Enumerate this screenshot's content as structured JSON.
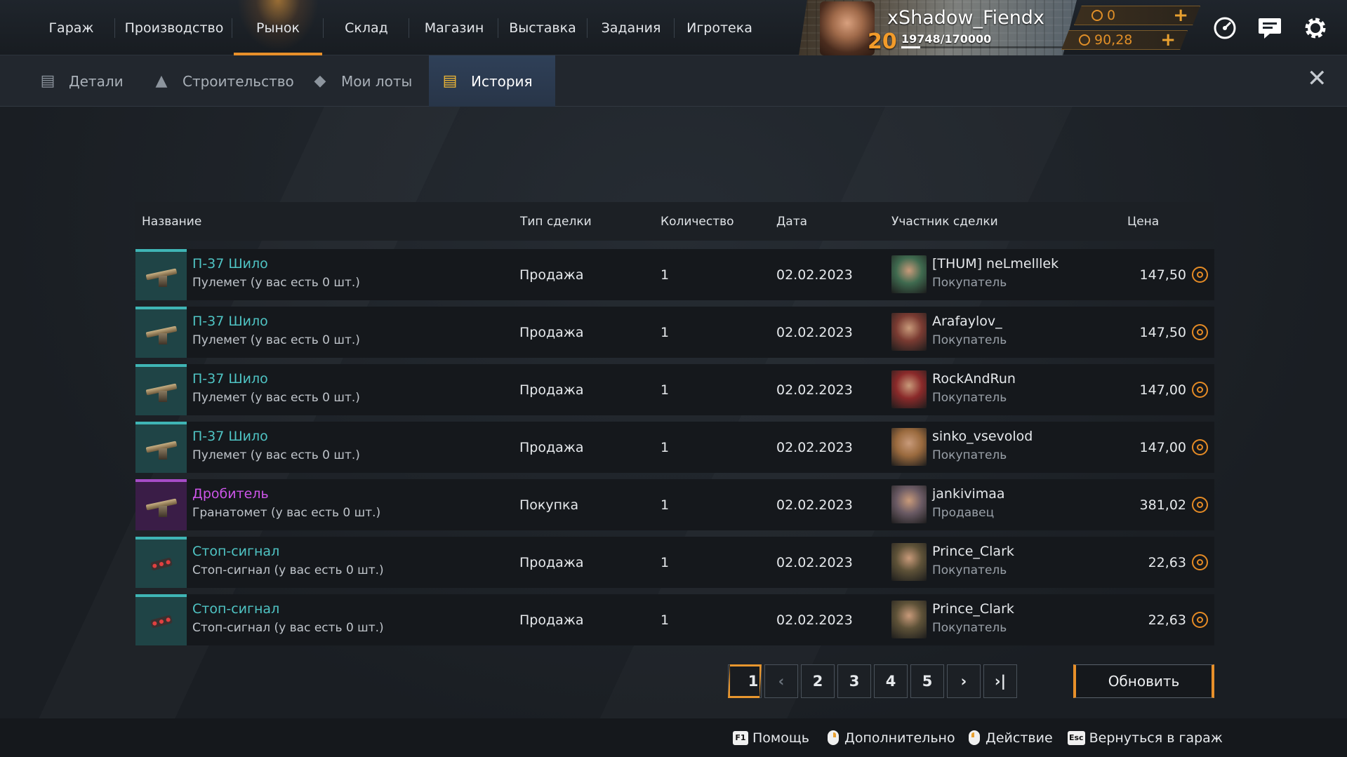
{
  "nav": [
    "Гараж",
    "Производство",
    "Рынок",
    "Склад",
    "Магазин",
    "Выставка",
    "Задания",
    "Игротека"
  ],
  "profile": {
    "name": "xShadow_Fiendx",
    "level": "20",
    "xp": "19748/170000",
    "xp_fraction": 0.116
  },
  "currency": {
    "coins": "0",
    "gold": "90,28"
  },
  "subtabs": [
    "Детали",
    "Строительство",
    "Мои лоты",
    "История"
  ],
  "columns": {
    "name": "Название",
    "type": "Тип сделки",
    "qty": "Количество",
    "date": "Дата",
    "participant": "Участник сделки",
    "price": "Цена"
  },
  "rows": [
    {
      "title": "П-37 Шило",
      "subtitle": "Пулемет (у вас есть 0 шт.)",
      "type": "Продажа",
      "qty": "1",
      "date": "02.02.2023",
      "participant": "[THUM] neLmelllek",
      "role": "Покупатель",
      "price": "147,50",
      "rarity": "rare",
      "icon": "machine-gun",
      "avatar_color": "#3f6a4f"
    },
    {
      "title": "П-37 Шило",
      "subtitle": "Пулемет (у вас есть 0 шт.)",
      "type": "Продажа",
      "qty": "1",
      "date": "02.02.2023",
      "participant": "Arafaylov_",
      "role": "Покупатель",
      "price": "147,50",
      "rarity": "rare",
      "icon": "machine-gun",
      "avatar_color": "#7a3b32"
    },
    {
      "title": "П-37 Шило",
      "subtitle": "Пулемет (у вас есть 0 шт.)",
      "type": "Продажа",
      "qty": "1",
      "date": "02.02.2023",
      "participant": "RockAndRun",
      "role": "Покупатель",
      "price": "147,00",
      "rarity": "rare",
      "icon": "machine-gun",
      "avatar_color": "#8a2a2a"
    },
    {
      "title": "П-37 Шило",
      "subtitle": "Пулемет (у вас есть 0 шт.)",
      "type": "Продажа",
      "qty": "1",
      "date": "02.02.2023",
      "participant": "sinko_vsevolod",
      "role": "Покупатель",
      "price": "147,00",
      "rarity": "rare",
      "icon": "machine-gun",
      "avatar_color": "#9a6a3e"
    },
    {
      "title": "Дробитель",
      "subtitle": "Гранатомет (у вас есть 0 шт.)",
      "type": "Покупка",
      "qty": "1",
      "date": "02.02.2023",
      "participant": "jankivimaa",
      "role": "Продавец",
      "price": "381,02",
      "rarity": "epic",
      "icon": "grenade-launcher",
      "avatar_color": "#6a5a64"
    },
    {
      "title": "Стоп-сигнал",
      "subtitle": "Стоп-сигнал (у вас есть 0 шт.)",
      "type": "Продажа",
      "qty": "1",
      "date": "02.02.2023",
      "participant": "Prince_Clark",
      "role": "Покупатель",
      "price": "22,63",
      "rarity": "rare",
      "icon": "stop-light",
      "avatar_color": "#5e5238"
    },
    {
      "title": "Стоп-сигнал",
      "subtitle": "Стоп-сигнал (у вас есть 0 шт.)",
      "type": "Продажа",
      "qty": "1",
      "date": "02.02.2023",
      "participant": "Prince_Clark",
      "role": "Покупатель",
      "price": "22,63",
      "rarity": "rare",
      "icon": "stop-light",
      "avatar_color": "#5e5238"
    }
  ],
  "pagination": {
    "pages": [
      "1",
      "2",
      "3",
      "4",
      "5"
    ],
    "current": "1"
  },
  "refresh_label": "Обновить",
  "footer": [
    {
      "key": "F1",
      "label": "Помощь"
    },
    {
      "key": "mouse-right",
      "label": "Дополнительно"
    },
    {
      "key": "mouse-left",
      "label": "Действие"
    },
    {
      "key": "Esc",
      "label": "Вернуться в гараж"
    }
  ],
  "colors": {
    "accent": "#e8902a",
    "rare": "#4fc4c4",
    "epic": "#cc55e8"
  }
}
